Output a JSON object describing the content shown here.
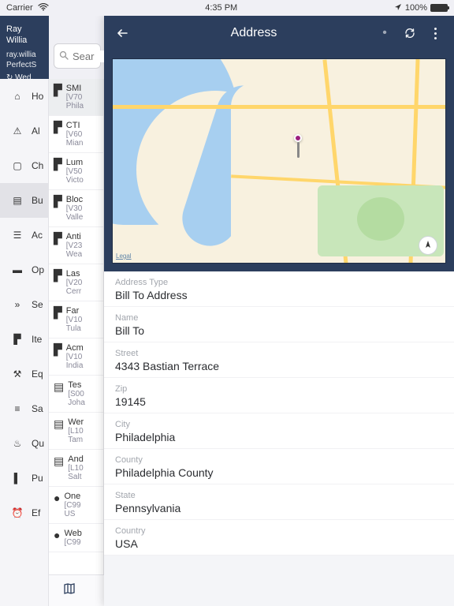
{
  "status": {
    "carrier": "Carrier",
    "wifi": "●",
    "time": "4:35 PM",
    "battery": "100%"
  },
  "user": {
    "name": "Ray Willia",
    "email": "ray.willia",
    "tenant": "PerfectS",
    "sync": "Wed,"
  },
  "search": {
    "placeholder": "Sear"
  },
  "nav": [
    {
      "icon": "home-icon",
      "glyph": "⌂",
      "label": "Ho",
      "active": false
    },
    {
      "icon": "alert-icon",
      "glyph": "⚠",
      "label": "Al",
      "active": false
    },
    {
      "icon": "clipboard-icon",
      "glyph": "▢",
      "label": "Ch",
      "active": false
    },
    {
      "icon": "building-icon",
      "glyph": "▤",
      "label": "Bu",
      "active": true
    },
    {
      "icon": "list-icon",
      "glyph": "☰",
      "label": "Ac",
      "active": false
    },
    {
      "icon": "store-icon",
      "glyph": "▬",
      "label": "Op",
      "active": false
    },
    {
      "icon": "services-icon",
      "glyph": "»",
      "label": "Se",
      "active": false
    },
    {
      "icon": "cart-icon",
      "glyph": "▛",
      "label": "Ite",
      "active": false
    },
    {
      "icon": "wrench-icon",
      "glyph": "⚒",
      "label": "Eq",
      "active": false
    },
    {
      "icon": "document-icon",
      "glyph": "≡",
      "label": "Sa",
      "active": false
    },
    {
      "icon": "hot-icon",
      "glyph": "♨",
      "label": "Qu",
      "active": false
    },
    {
      "icon": "receipt-icon",
      "glyph": "▌",
      "label": "Pu",
      "active": false
    },
    {
      "icon": "clock-icon",
      "glyph": "⏰",
      "label": "Ef",
      "active": false
    }
  ],
  "list": [
    {
      "ic": "building-cart-icon",
      "g": "▛",
      "t1": "SMI",
      "t2": "[V70",
      "t3": "Phila",
      "sel": true
    },
    {
      "ic": "building-cart-icon",
      "g": "▛",
      "t1": "CTI",
      "t2": "[V60",
      "t3": "Mian"
    },
    {
      "ic": "building-cart-icon",
      "g": "▛",
      "t1": "Lum",
      "t2": "[V50",
      "t3": "Victo"
    },
    {
      "ic": "building-cart-icon",
      "g": "▛",
      "t1": "Bloc",
      "t2": "[V30",
      "t3": "Valle"
    },
    {
      "ic": "building-cart-icon",
      "g": "▛",
      "t1": "Anti",
      "t2": "[V23",
      "t3": "Wea"
    },
    {
      "ic": "building-cart-icon",
      "g": "▛",
      "t1": "Las",
      "t2": "[V20",
      "t3": "Cerr"
    },
    {
      "ic": "building-cart-icon",
      "g": "▛",
      "t1": "Far",
      "t2": "[V10",
      "t3": "Tula"
    },
    {
      "ic": "building-cart-icon",
      "g": "▛",
      "t1": "Acm",
      "t2": "[V10",
      "t3": "India"
    },
    {
      "ic": "building-icon",
      "g": "▤",
      "t1": "Tes",
      "t2": "[S00",
      "t3": "Joha"
    },
    {
      "ic": "building-question-icon",
      "g": "▤",
      "t1": "Wer",
      "t2": "[L10",
      "t3": "Tam"
    },
    {
      "ic": "building-question-icon",
      "g": "▤",
      "t1": "And",
      "t2": "[L10",
      "t3": "Salt"
    },
    {
      "ic": "person-icon",
      "g": "●",
      "t1": "One",
      "t2": "[C99",
      "t3": "US"
    },
    {
      "ic": "person-icon",
      "g": "●",
      "t1": "Web",
      "t2": "[C99",
      "t3": ""
    }
  ],
  "detail": {
    "title": "Address",
    "map": {
      "legal": "Legal"
    },
    "fields": [
      {
        "label": "Address Type",
        "value": "Bill To Address"
      },
      {
        "label": "Name",
        "value": "Bill To"
      },
      {
        "label": "Street",
        "value": "4343 Bastian Terrace"
      },
      {
        "label": "Zip",
        "value": "19145"
      },
      {
        "label": "City",
        "value": "Philadelphia"
      },
      {
        "label": "County",
        "value": "Philadelphia County"
      },
      {
        "label": "State",
        "value": "Pennsylvania"
      },
      {
        "label": "Country",
        "value": "USA"
      }
    ]
  }
}
